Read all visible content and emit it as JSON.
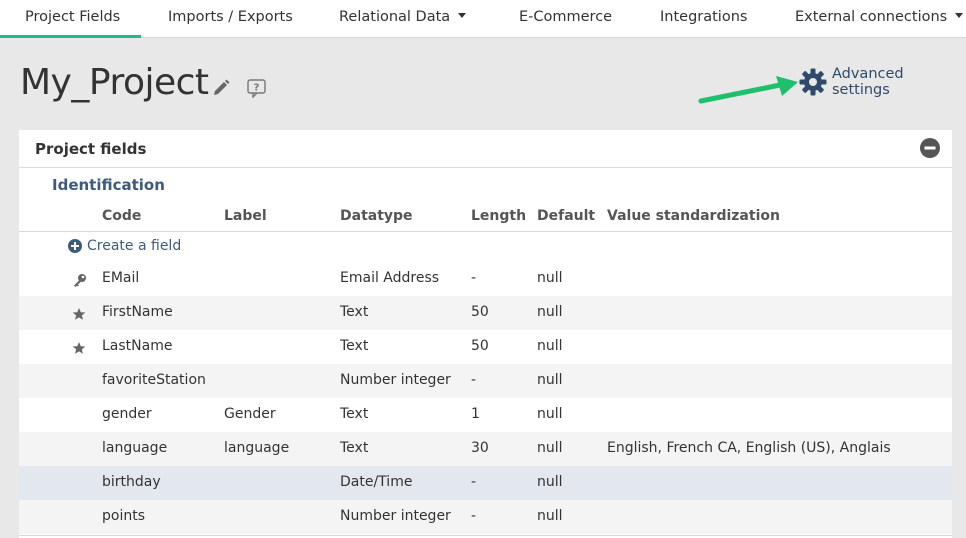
{
  "nav": {
    "tabs": [
      {
        "label": "Project Fields",
        "active": true
      },
      {
        "label": "Imports / Exports"
      },
      {
        "label": "Relational Data",
        "dropdown": true
      },
      {
        "label": "E-Commerce"
      },
      {
        "label": "Integrations"
      },
      {
        "label": "External connections",
        "dropdown": true
      }
    ]
  },
  "header": {
    "title": "My_Project",
    "advanced_settings_label": "Advanced settings"
  },
  "panel": {
    "title": "Project fields",
    "section_title": "Identification",
    "columns": [
      "Code",
      "Label",
      "Datatype",
      "Length",
      "Default",
      "Value standardization"
    ],
    "create_label": "Create a field",
    "rows": [
      {
        "icon": "key-icon",
        "code": "EMail",
        "label": "",
        "datatype": "Email Address",
        "length": "-",
        "default": "null",
        "standardization": ""
      },
      {
        "icon": "star-icon",
        "code": "FirstName",
        "label": "",
        "datatype": "Text",
        "length": "50",
        "default": "null",
        "standardization": ""
      },
      {
        "icon": "star-icon",
        "code": "LastName",
        "label": "",
        "datatype": "Text",
        "length": "50",
        "default": "null",
        "standardization": ""
      },
      {
        "icon": "",
        "code": "favoriteStation",
        "label": "",
        "datatype": "Number integer",
        "length": "-",
        "default": "null",
        "standardization": ""
      },
      {
        "icon": "",
        "code": "gender",
        "label": "Gender",
        "datatype": "Text",
        "length": "1",
        "default": "null",
        "standardization": ""
      },
      {
        "icon": "",
        "code": "language",
        "label": "language",
        "datatype": "Text",
        "length": "30",
        "default": "null",
        "standardization": "English, French CA, English (US), Anglais"
      },
      {
        "icon": "",
        "code": "birthday",
        "label": "",
        "datatype": "Date/Time",
        "length": "-",
        "default": "null",
        "standardization": "",
        "selected": true
      },
      {
        "icon": "",
        "code": "points",
        "label": "",
        "datatype": "Number integer",
        "length": "-",
        "default": "null",
        "standardization": ""
      }
    ]
  },
  "colors": {
    "accent": "#1abc8c",
    "link": "#3d5b7d",
    "gear": "#2f4a6b",
    "arrow": "#1fbf6e"
  }
}
